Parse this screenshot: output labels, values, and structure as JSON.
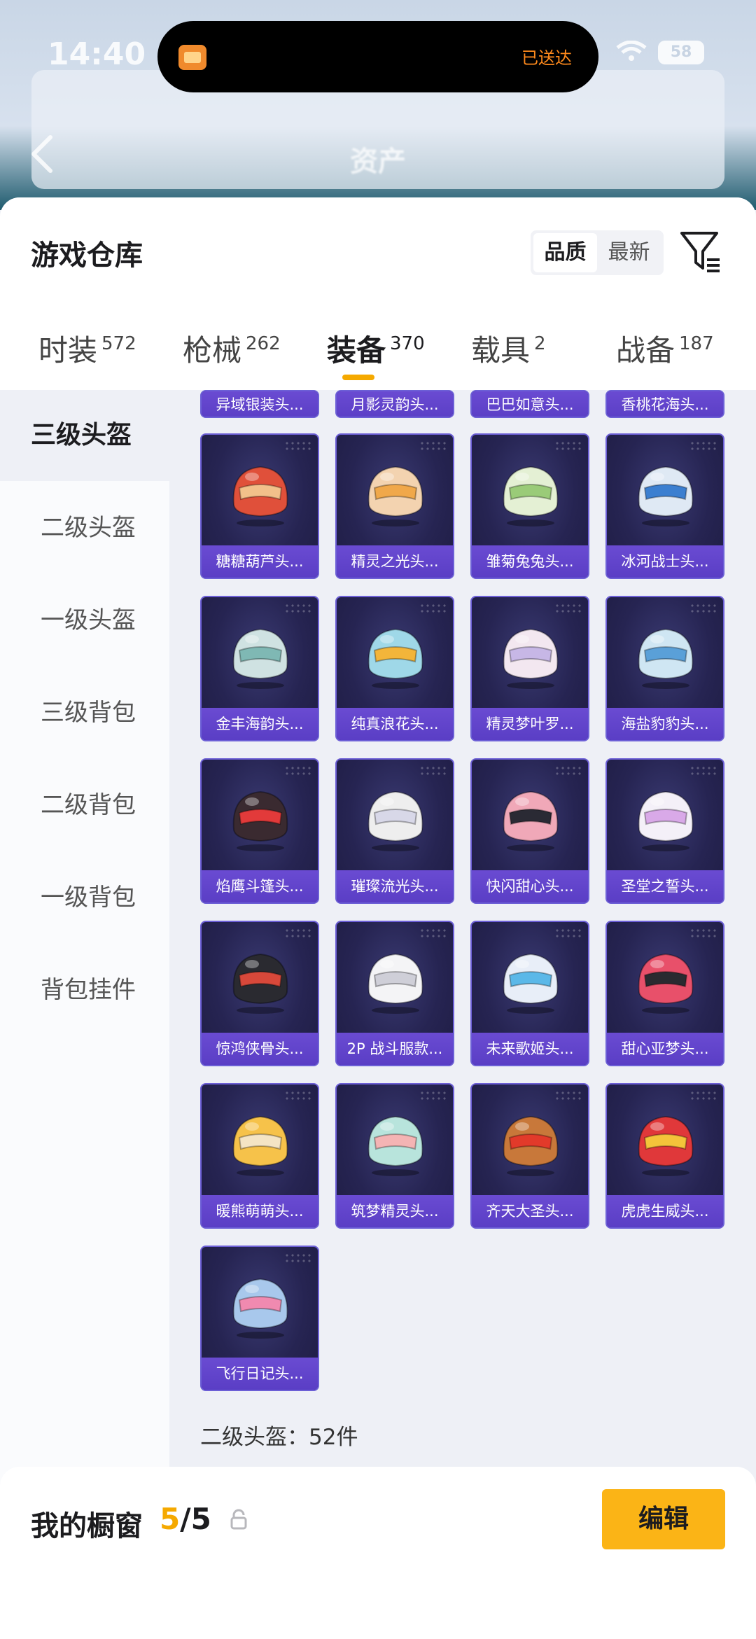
{
  "status": {
    "time": "14:40",
    "island_text": "已送达",
    "battery": "58"
  },
  "background_header": {
    "title": "资产"
  },
  "sheet": {
    "title": "游戏仓库",
    "sort_options": [
      "品质",
      "最新"
    ],
    "sort_selected": "品质"
  },
  "tabs": [
    {
      "label": "时装",
      "count": "572"
    },
    {
      "label": "枪械",
      "count": "262"
    },
    {
      "label": "装备",
      "count": "370"
    },
    {
      "label": "载具",
      "count": "2"
    },
    {
      "label": "战备",
      "count": "187"
    }
  ],
  "active_tab": "装备",
  "sidebar": [
    {
      "label": "三级头盔"
    },
    {
      "label": "二级头盔"
    },
    {
      "label": "一级头盔"
    },
    {
      "label": "三级背包"
    },
    {
      "label": "二级背包"
    },
    {
      "label": "一级背包"
    },
    {
      "label": "背包挂件"
    }
  ],
  "active_sidebar": "三级头盔",
  "partial_row": [
    "异域银装头...",
    "月影灵韵头...",
    "巴巴如意头...",
    "香桃花海头..."
  ],
  "items": [
    {
      "name": "糖糖葫芦头...",
      "color": "#e0503a",
      "accent": "#f2c08a"
    },
    {
      "name": "精灵之光头...",
      "color": "#f3d3b0",
      "accent": "#f0a84a"
    },
    {
      "name": "雏菊兔兔头...",
      "color": "#e4f0d4",
      "accent": "#9acb78"
    },
    {
      "name": "冰河战士头...",
      "color": "#dfe9f4",
      "accent": "#3b7fd0"
    },
    {
      "name": "金丰海韵头...",
      "color": "#cfe2e2",
      "accent": "#7fb8b4"
    },
    {
      "name": "纯真浪花头...",
      "color": "#9fd8e8",
      "accent": "#f3b53a"
    },
    {
      "name": "精灵梦叶罗...",
      "color": "#f3e7f0",
      "accent": "#c7b7e6"
    },
    {
      "name": "海盐豹豹头...",
      "color": "#cfe6f3",
      "accent": "#5aa0d8"
    },
    {
      "name": "焰鹰斗篷头...",
      "color": "#3a2a30",
      "accent": "#e23a3a"
    },
    {
      "name": "璀璨流光头...",
      "color": "#eeeeee",
      "accent": "#d8d8e8"
    },
    {
      "name": "快闪甜心头...",
      "color": "#f0a8b8",
      "accent": "#2a2a34"
    },
    {
      "name": "圣堂之誓头...",
      "color": "#f4f0f8",
      "accent": "#d9a9e8"
    },
    {
      "name": "惊鸿侠骨头...",
      "color": "#2a2a30",
      "accent": "#d8483a"
    },
    {
      "name": "2P 战斗服款...",
      "color": "#f4f4f6",
      "accent": "#cfcfd8"
    },
    {
      "name": "未来歌姬头...",
      "color": "#e8eef8",
      "accent": "#5bb8e8"
    },
    {
      "name": "甜心亚梦头...",
      "color": "#e8506a",
      "accent": "#2a2a30"
    },
    {
      "name": "暖熊萌萌头...",
      "color": "#f6c24a",
      "accent": "#f4e4c4"
    },
    {
      "name": "筑梦精灵头...",
      "color": "#b8e4dc",
      "accent": "#f4b4b4"
    },
    {
      "name": "齐天大圣头...",
      "color": "#c8783a",
      "accent": "#e23a2a"
    },
    {
      "name": "虎虎生威头...",
      "color": "#e0383a",
      "accent": "#f4c43a"
    },
    {
      "name": "飞行日记头...",
      "color": "#a8c8ec",
      "accent": "#f08ab0"
    }
  ],
  "section_label": "二级头盔：52件",
  "bottom_bar": {
    "title": "我的橱窗",
    "count_current": "5",
    "count_sep_total": "/5",
    "edit_label": "编辑"
  },
  "icons": {
    "back": "chevron-left-icon",
    "filter": "filter-icon",
    "share": "external-link-icon",
    "lock": "lock-icon"
  },
  "colors": {
    "accent": "#fbb416",
    "card_bg": "#262452",
    "card_label_bg": "#5a3ec5"
  }
}
